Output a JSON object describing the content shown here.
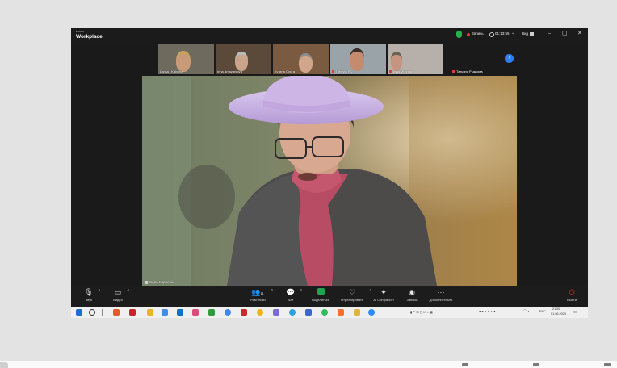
{
  "window": {
    "brand_small": "zoom",
    "brand_main": "Workplace",
    "recording_label": "Запись",
    "timer": "01:13:55",
    "view_label": "Вид",
    "minimize": "–",
    "maximize": "▢",
    "close": "✕"
  },
  "gallery": [
    {
      "name": "Larisa | Kalyuna",
      "bg": "#6e6a5e",
      "face": "#c99a78",
      "hair": "#c7a05a",
      "muted": false
    },
    {
      "name": "Irina Amazarkova",
      "bg": "#5b4a3a",
      "face": "#c9a48a",
      "hair": "#b9b9b9",
      "muted": false
    },
    {
      "name": "Кутина Ольга",
      "bg": "#7a5a40",
      "face": "#d2a68a",
      "hair": "#8c8c8c",
      "muted": false
    },
    {
      "name": "Перлас РС",
      "bg": "#9aa3a8",
      "face": "#c58b6e",
      "hair": "#3a2e28",
      "muted": true
    },
    {
      "name": "Irina Murzina",
      "bg": "#b7b0aa",
      "face": "#c79480",
      "hair": "#6c6055",
      "muted": true
    }
  ],
  "gallery_name_only": {
    "name": "Татьяна Рыжкова",
    "muted": true
  },
  "speaker": {
    "name": "Вера Харченко"
  },
  "toolbar": {
    "audio": "Звук",
    "video": "Видео",
    "participants": "Участники",
    "participants_count": "11",
    "chat": "Чат",
    "share": "Поделиться",
    "react": "Отреагировать",
    "ai": "AI Companion",
    "record": "Запись",
    "more": "Дополнительно",
    "leave": "Выйти"
  },
  "taskbar": {
    "lang": "РУС",
    "time": "21:55",
    "date": "01.06.2025"
  },
  "colors": {
    "accent_blue": "#2f7cf6",
    "record_red": "#e0362e",
    "secure_green": "#23b24b",
    "share_green": "#21a450"
  }
}
